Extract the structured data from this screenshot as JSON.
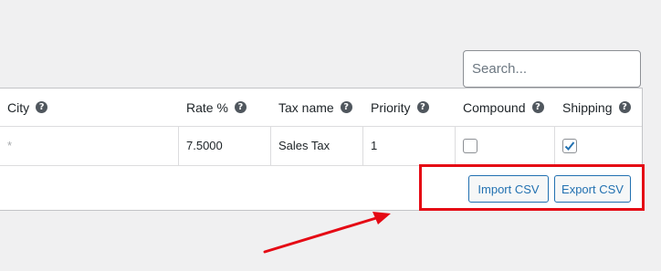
{
  "search": {
    "placeholder": "Search..."
  },
  "table": {
    "columns": [
      {
        "label": "City",
        "help_icon": "question-circle-icon"
      },
      {
        "label": "Rate %",
        "help_icon": "question-circle-icon"
      },
      {
        "label": "Tax name",
        "help_icon": "question-circle-icon"
      },
      {
        "label": "Priority",
        "help_icon": "question-circle-icon"
      },
      {
        "label": "Compound",
        "help_icon": "question-circle-icon"
      },
      {
        "label": "Shipping",
        "help_icon": "question-circle-icon"
      }
    ],
    "help_glyph": "?",
    "row": {
      "city": "*",
      "rate": "7.5000",
      "tax_name": "Sales Tax",
      "priority": "1",
      "compound_checked": false,
      "shipping_checked": true
    }
  },
  "actions": {
    "import_label": "Import CSV",
    "export_label": "Export CSV"
  },
  "annotation": {
    "color": "#e50914"
  },
  "colors": {
    "accent": "#2271b1",
    "background": "#f0f0f1"
  }
}
